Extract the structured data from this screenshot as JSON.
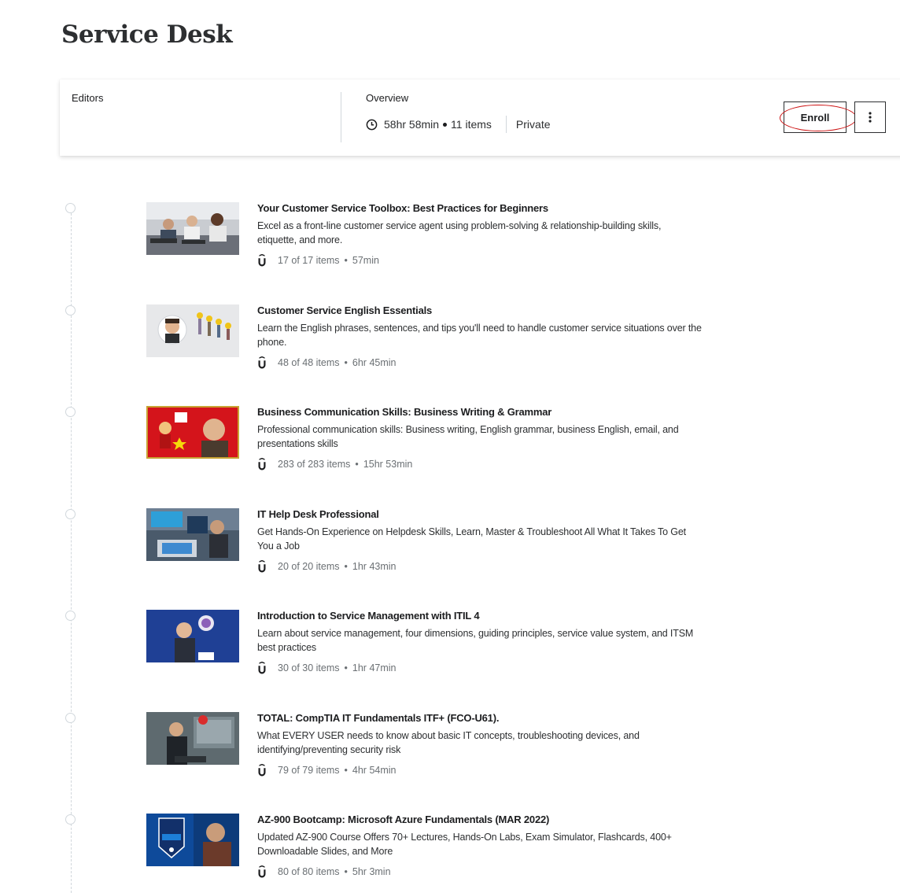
{
  "page": {
    "title": "Service Desk"
  },
  "overview_card": {
    "editors_label": "Editors",
    "overview_label": "Overview",
    "duration": "58hr 58min",
    "item_count": "11 items",
    "visibility": "Private",
    "enroll_label": "Enroll",
    "more_icon": "vertical-ellipsis-icon",
    "clock_icon": "clock-icon"
  },
  "courses": [
    {
      "title": "Your Customer Service Toolbox: Best Practices for Beginners",
      "description": "Excel as a front-line customer service agent using problem-solving & relationship-building skills, etiquette, and more.",
      "items": "17 of 17 items",
      "duration": "57min"
    },
    {
      "title": "Customer Service English Essentials",
      "description": "Learn the English phrases, sentences, and tips you'll need to handle customer service situations over the phone.",
      "items": "48 of 48 items",
      "duration": "6hr 45min"
    },
    {
      "title": "Business Communication Skills: Business Writing & Grammar",
      "description": "Professional communication skills: Business writing, English grammar, business English, email, and presentations skills",
      "items": "283 of 283 items",
      "duration": "15hr 53min"
    },
    {
      "title": "IT Help Desk Professional",
      "description": "Get Hands-On Experience on Helpdesk Skills, Learn, Master & Troubleshoot All What It Takes To Get You a Job",
      "items": "20 of 20 items",
      "duration": "1hr 43min"
    },
    {
      "title": "Introduction to Service Management with ITIL 4",
      "description": "Learn about service management, four dimensions, guiding principles, service value system, and ITSM best practices",
      "items": "30 of 30 items",
      "duration": "1hr 47min"
    },
    {
      "title": "TOTAL: CompTIA IT Fundamentals ITF+ (FCO-U61).",
      "description": "What EVERY USER needs to know about basic IT concepts, troubleshooting devices, and identifying/preventing security risk",
      "items": "79 of 79 items",
      "duration": "4hr 54min"
    },
    {
      "title": "AZ-900 Bootcamp: Microsoft Azure Fundamentals (MAR 2022)",
      "description": "Updated AZ-900 Course Offers 70+ Lectures, Hands-On Labs, Exam Simulator, Flashcards, 400+ Downloadable Slides, and More",
      "items": "80 of 80 items",
      "duration": "5hr 3min"
    }
  ],
  "meta_separator": "•",
  "course_icon": "udemy-logo-icon",
  "colors": {
    "enroll_highlight": "#cc1010",
    "border": "#2d2f31",
    "muted_text": "#6a6f73",
    "divider": "#d1d7dc"
  }
}
